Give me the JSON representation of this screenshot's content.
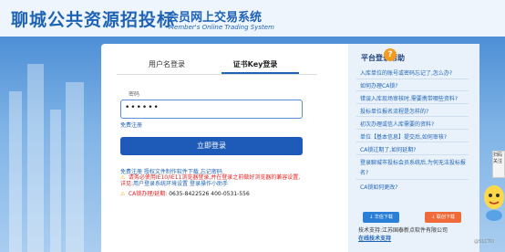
{
  "header": {
    "site_title": "聊城公共资源招投标",
    "system_title": "会员网上交易系统",
    "system_subtitle": "Member's Online Trading System"
  },
  "login": {
    "tabs": [
      {
        "label": "用户名登录",
        "active": false
      },
      {
        "label": "证书Key登录",
        "active": true
      }
    ],
    "password_label": "密码",
    "password_value": "••••••",
    "free_register": "免费注册",
    "login_button": "立即登录",
    "bottom_links": "免费注册  授权文件制作软件下载  忘记密码",
    "warning_red": "请务必使用IE10/IE11浏览器登录,并在登录之前做好浏览器的兼容设置,详见:",
    "warning_link": "用户登录系统环境设置",
    "warning_link2": "登录操作小助手",
    "ca_label": "CA锁办理/延期:",
    "ca_phones": "0635-8422526 400-0531-556"
  },
  "help": {
    "title": "平台登录帮助",
    "icon": "question-icon",
    "items": [
      "入库单位的账号或密码忘记了,怎么办?",
      "如何办理CA锁?",
      "错误入库现场审核时,需要携带哪些资料?",
      "投标单位报名流程是怎样的?",
      "初次办理或信人库需要的资料?",
      "单位【基本信息】提交后,如何审核?",
      "CA锁过期了,如何延期?",
      "登录聊城市投标会员系统后,为何无法投标报名?",
      "CA锁如何更改?"
    ],
    "download_buttons": [
      "↓ 华信下载",
      "↓ 联创下载"
    ],
    "tech_support": "技术支持:江苏国泰新点软件有限公司",
    "online_support": "在线技术支持"
  },
  "side_popup": "扫码关注",
  "watermark": "@51CTO",
  "colors": {
    "brand": "#1f63b6",
    "button": "#1e5bb8",
    "warning": "#dd2222",
    "accent_orange": "#f39b1f"
  }
}
